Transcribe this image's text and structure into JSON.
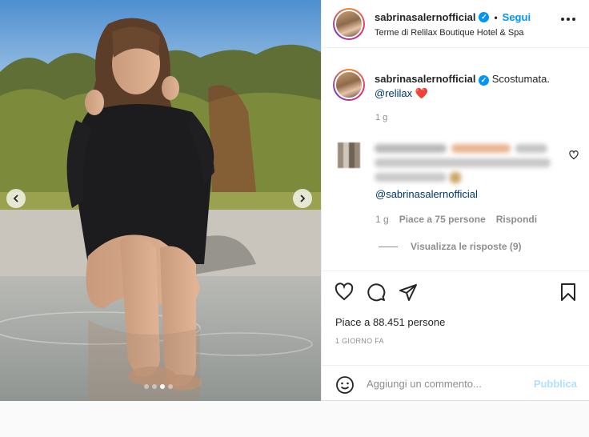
{
  "post": {
    "username": "sabrinasalernofficial",
    "follow_label": "Segui",
    "separator": "•",
    "location": "Terme di Relilax Boutique Hotel & Spa",
    "caption_text": "Scostumata.",
    "caption_mention": "@relilax",
    "caption_emoji": "❤️",
    "caption_time": "1 g",
    "likes_label": "Piace a 88.451 persone",
    "date_label": "1 GIORNO FA",
    "carousel": {
      "slides": 4,
      "active_index": 2
    }
  },
  "comment": {
    "mention": "@sabrinasalernofficial",
    "time": "1 g",
    "likes": "Piace a 75 persone",
    "reply_label": "Rispondi",
    "view_replies": "Visualizza le risposte (9)"
  },
  "composer": {
    "placeholder": "Aggiungi un commento...",
    "publish_label": "Pubblica"
  },
  "icons": {
    "verified": "verified-badge-icon",
    "more": "more-options-icon",
    "like": "heart-icon",
    "comment": "comment-icon",
    "share": "share-icon",
    "save": "bookmark-icon",
    "emoji": "emoji-icon",
    "prev": "chevron-left-icon",
    "next": "chevron-right-icon"
  },
  "colors": {
    "accent": "#0095f6",
    "publish_disabled": "#b2dffc",
    "mention": "#00376b",
    "muted": "#8e8e8e"
  }
}
